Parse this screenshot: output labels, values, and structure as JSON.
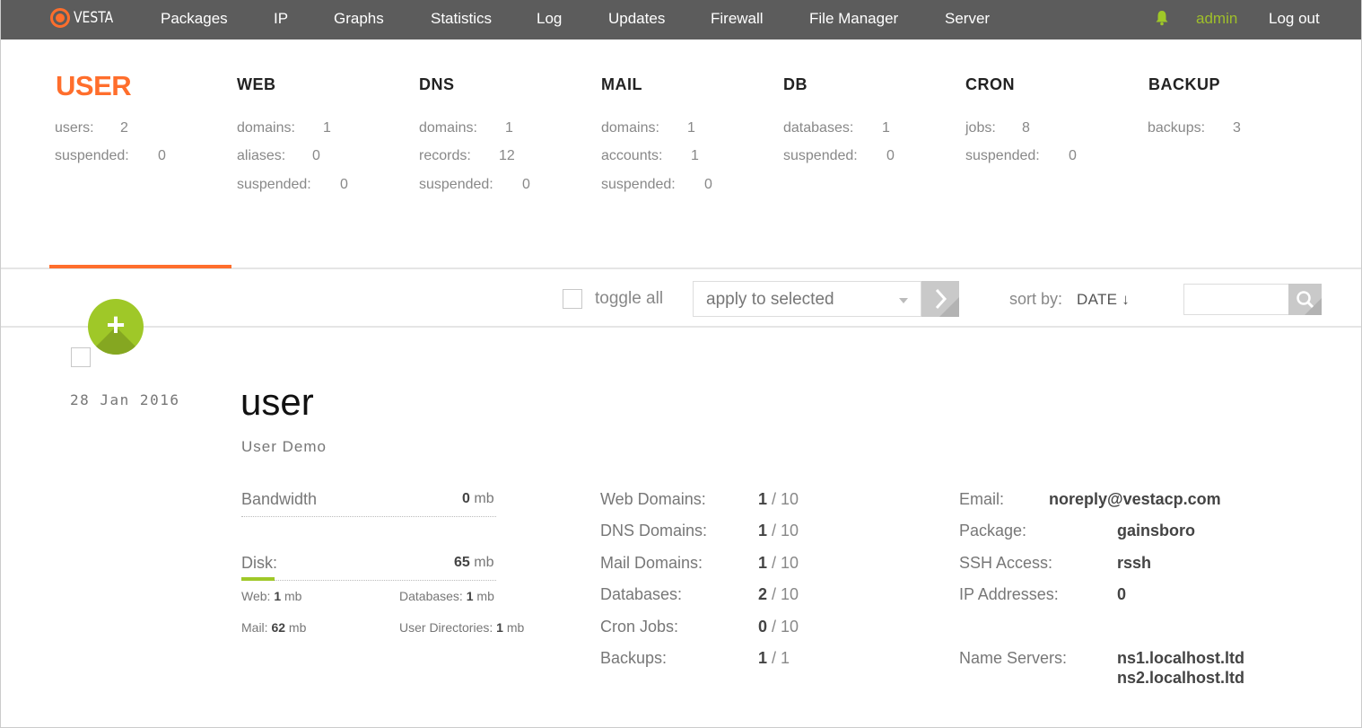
{
  "nav": {
    "logo": "VESTA",
    "items": [
      "Packages",
      "IP",
      "Graphs",
      "Statistics",
      "Log",
      "Updates",
      "Firewall",
      "File Manager",
      "Server"
    ],
    "user": "admin",
    "logout": "Log out"
  },
  "stats": {
    "user": {
      "title": "USER",
      "rows": [
        {
          "label": "users:",
          "value": "2"
        },
        {
          "label": "suspended:",
          "value": "0"
        }
      ]
    },
    "web": {
      "title": "WEB",
      "rows": [
        {
          "label": "domains:",
          "value": "1"
        },
        {
          "label": "aliases:",
          "value": "0"
        },
        {
          "label": "suspended:",
          "value": "0"
        }
      ]
    },
    "dns": {
      "title": "DNS",
      "rows": [
        {
          "label": "domains:",
          "value": "1"
        },
        {
          "label": "records:",
          "value": "12"
        },
        {
          "label": "suspended:",
          "value": "0"
        }
      ]
    },
    "mail": {
      "title": "MAIL",
      "rows": [
        {
          "label": "domains:",
          "value": "1"
        },
        {
          "label": "accounts:",
          "value": "1"
        },
        {
          "label": "suspended:",
          "value": "0"
        }
      ]
    },
    "db": {
      "title": "DB",
      "rows": [
        {
          "label": "databases:",
          "value": "1"
        },
        {
          "label": "suspended:",
          "value": "0"
        }
      ]
    },
    "cron": {
      "title": "CRON",
      "rows": [
        {
          "label": "jobs:",
          "value": "8"
        },
        {
          "label": "suspended:",
          "value": "0"
        }
      ]
    },
    "backup": {
      "title": "BACKUP",
      "rows": [
        {
          "label": "backups:",
          "value": "3"
        }
      ]
    }
  },
  "toolbar": {
    "toggle_all": "toggle all",
    "apply_selected": "apply to selected",
    "sort_label": "sort by:",
    "sort_value": "DATE ↓",
    "search_value": ""
  },
  "record": {
    "date": "28 Jan 2016",
    "name": "user",
    "full_name": "User Demo",
    "bandwidth_label": "Bandwidth",
    "bandwidth_value": "0",
    "disk_label": "Disk:",
    "disk_value": "65",
    "unit": "mb",
    "disk_fraction": 0.13,
    "web_label": "Web:",
    "web_value": "1",
    "databases_label": "Databases:",
    "databases_value": "1",
    "mail_label": "Mail:",
    "mail_value": "62",
    "userdirs_label": "User Directories:",
    "userdirs_value": "1",
    "limits": [
      {
        "label": "Web Domains:",
        "used": "1",
        "total": "/ 10"
      },
      {
        "label": "DNS Domains:",
        "used": "1",
        "total": "/ 10"
      },
      {
        "label": "Mail Domains:",
        "used": "1",
        "total": "/ 10"
      },
      {
        "label": "Databases:",
        "used": "2",
        "total": "/ 10"
      },
      {
        "label": "Cron Jobs:",
        "used": "0",
        "total": "/ 10"
      },
      {
        "label": "Backups:",
        "used": "1",
        "total": "/ 1"
      }
    ],
    "email_label": "Email:",
    "email": "noreply@vestacp.com",
    "package_label": "Package:",
    "package": "gainsboro",
    "ssh_label": "SSH Access:",
    "ssh": "rssh",
    "ip_label": "IP Addresses:",
    "ip": "0",
    "ns_label": "Name Servers:",
    "ns1": "ns1.localhost.ltd",
    "ns2": "ns2.localhost.ltd"
  },
  "colors": {
    "accent": "#ff6e2c",
    "green": "#9fc828",
    "nav_bg": "#5c5c5c"
  }
}
